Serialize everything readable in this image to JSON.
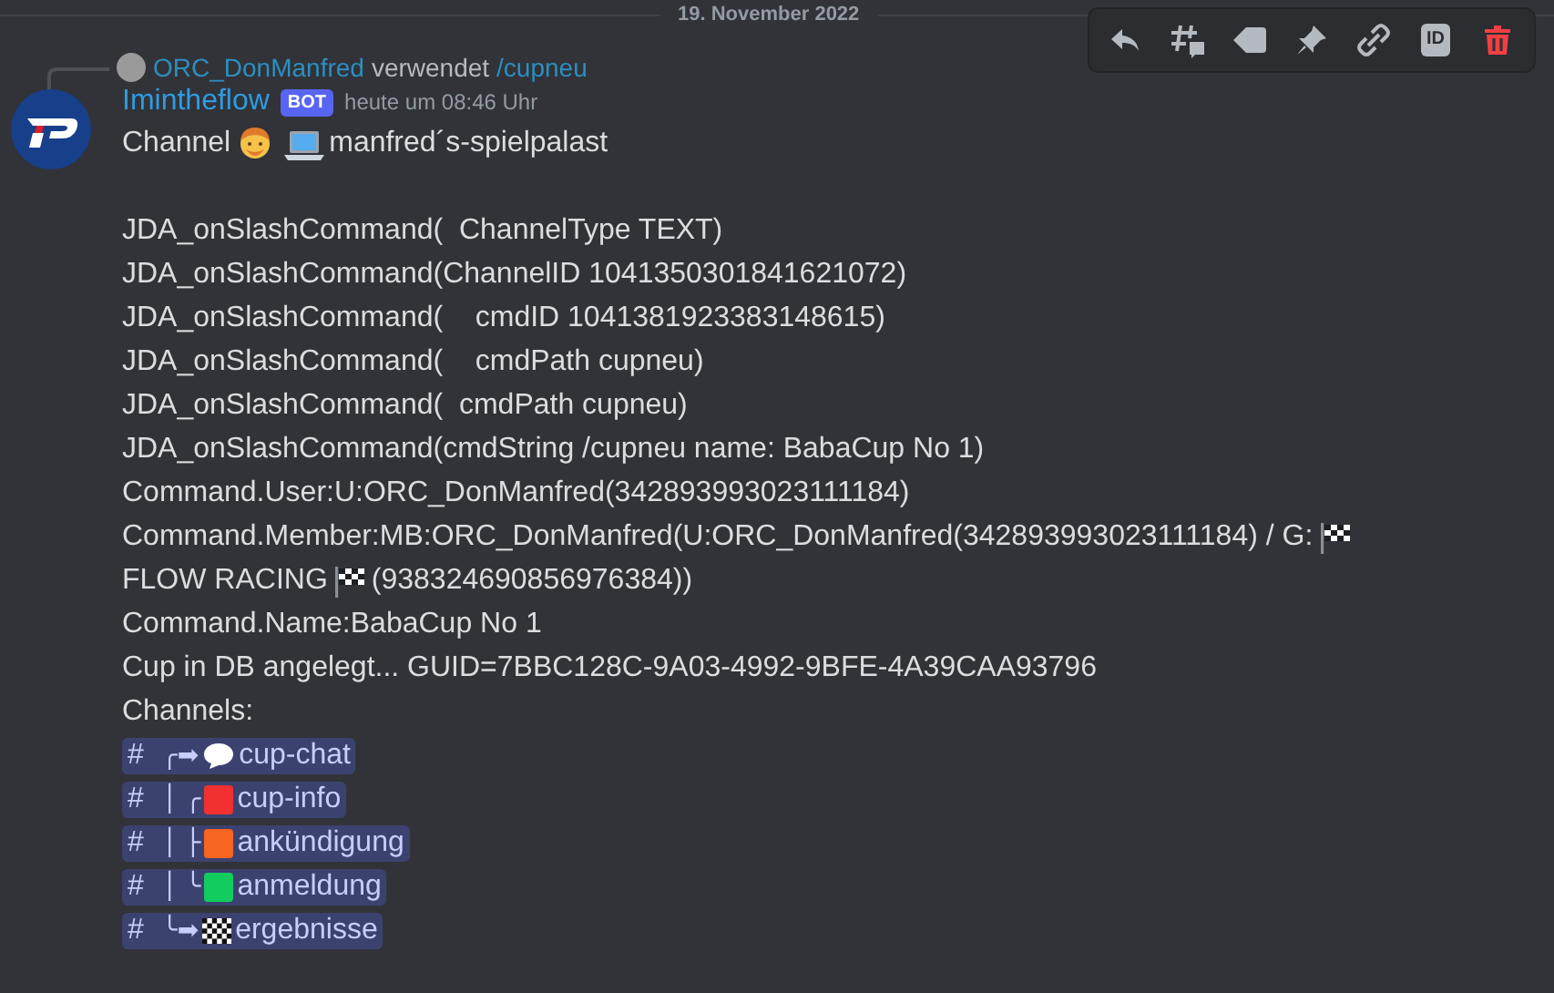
{
  "date_divider": "19. November 2022",
  "toolbar": [
    {
      "kind": "reply"
    },
    {
      "kind": "thread"
    },
    {
      "kind": "tag"
    },
    {
      "kind": "pin"
    },
    {
      "kind": "link"
    },
    {
      "kind": "id",
      "label": "ID"
    },
    {
      "kind": "delete"
    }
  ],
  "reply": {
    "user": "ORC_DonManfred",
    "verb": "verwendet",
    "command": "/cupneu"
  },
  "message": {
    "author": "Imintheflow",
    "badge": "BOT",
    "timestamp": "heute um 08:46 Uhr",
    "lines": [
      {
        "parts": [
          {
            "kind": "text",
            "text": "Channel"
          },
          {
            "kind": "person"
          },
          {
            "kind": "laptop"
          },
          {
            "kind": "text",
            "text": "manfred´s-spielpalast"
          }
        ]
      },
      {
        "kind": "blank"
      },
      {
        "parts": [
          {
            "kind": "text",
            "text": "JDA_onSlashCommand(  ChannelType TEXT)"
          }
        ]
      },
      {
        "parts": [
          {
            "kind": "text",
            "text": "JDA_onSlashCommand(ChannelID 1041350301841621072)"
          }
        ]
      },
      {
        "parts": [
          {
            "kind": "text",
            "text": "JDA_onSlashCommand(    cmdID 1041381923383148615)"
          }
        ]
      },
      {
        "parts": [
          {
            "kind": "text",
            "text": "JDA_onSlashCommand(    cmdPath cupneu)"
          }
        ]
      },
      {
        "parts": [
          {
            "kind": "text",
            "text": "JDA_onSlashCommand(  cmdPath cupneu)"
          }
        ]
      },
      {
        "parts": [
          {
            "kind": "text",
            "text": "JDA_onSlashCommand(cmdString /cupneu name: BabaCup No 1)"
          }
        ]
      },
      {
        "parts": [
          {
            "kind": "text",
            "text": "Command.User:U:ORC_DonManfred(342893993023111184)"
          }
        ]
      },
      {
        "parts": [
          {
            "kind": "text",
            "text": "Command.Member:MB:ORC_DonManfred(U:ORC_DonManfred(342893993023111184) / G:"
          },
          {
            "kind": "flag"
          }
        ]
      },
      {
        "parts": [
          {
            "kind": "text",
            "text": "FLOW RACING"
          },
          {
            "kind": "flag"
          },
          {
            "kind": "text",
            "text": "(938324690856976384))"
          }
        ]
      },
      {
        "parts": [
          {
            "kind": "text",
            "text": "Command.Name:BabaCup No 1"
          }
        ]
      },
      {
        "parts": [
          {
            "kind": "text",
            "text": "Cup in DB angelegt... GUID=7BBC128C-9A03-4992-9BFE-4A39CAA93796"
          }
        ]
      },
      {
        "parts": [
          {
            "kind": "text",
            "text": "Channels:"
          }
        ]
      }
    ],
    "channels": [
      {
        "hash": "#",
        "tree": "╭➡",
        "kind": "bubble",
        "name": "cup-chat"
      },
      {
        "hash": "#",
        "tree": "│ ╭",
        "kind": "square",
        "color": "#f23030",
        "name": "cup-info"
      },
      {
        "hash": "#",
        "tree": "│ ├",
        "kind": "square",
        "color": "#f76520",
        "name": "ankündigung"
      },
      {
        "hash": "#",
        "tree": "│ ╰",
        "kind": "square",
        "color": "#12cc5e",
        "name": "anmeldung"
      },
      {
        "hash": "#",
        "tree": "╰➡",
        "kind": "checker",
        "name": "ergebnisse"
      }
    ]
  }
}
